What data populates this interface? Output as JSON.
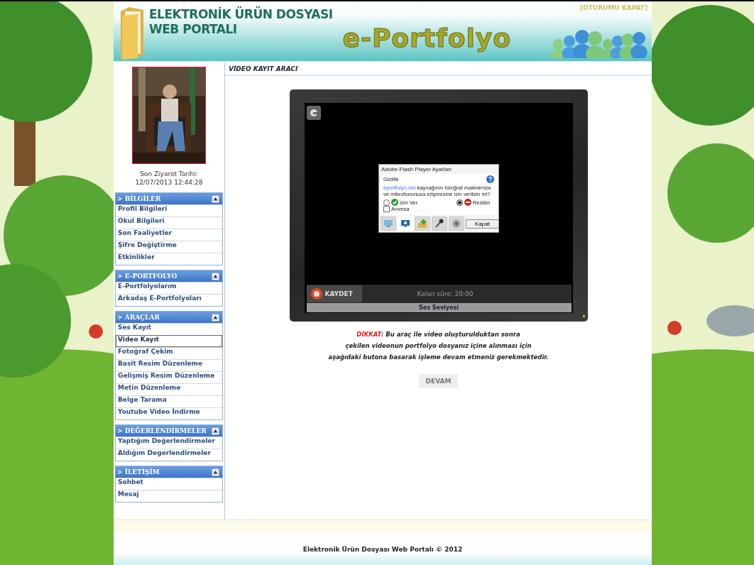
{
  "header": {
    "title_lines": [
      "ELEKTRONİK ÜRÜN DOSYASI",
      "WEB PORTALI"
    ],
    "logo": "e-Portfolyo",
    "logout_link": "[OTURUMU KAPAT]"
  },
  "profile": {
    "last_visit_label": "Son Ziyaret Tarihi:",
    "last_visit": "12/07/2013 12:44:28"
  },
  "menu": [
    {
      "title": "> BİLGİLER",
      "expanded": true,
      "items": [
        {
          "label": "Profil Bilgileri",
          "selected": false
        },
        {
          "label": "Okul Bilgileri",
          "selected": false
        },
        {
          "label": "Son Faaliyetler",
          "selected": false
        },
        {
          "label": "Şifre Değiştirme",
          "selected": false
        },
        {
          "label": "Etkinlikler",
          "selected": false
        }
      ]
    },
    {
      "title": "> E-PORTFOLYO",
      "expanded": true,
      "items": [
        {
          "label": "E-Portfolyolarım",
          "selected": false
        },
        {
          "label": "Arkadaş E-Portfolyoları",
          "selected": false
        }
      ]
    },
    {
      "title": "> ARAÇLAR",
      "expanded": true,
      "items": [
        {
          "label": "Ses Kayıt",
          "selected": false
        },
        {
          "label": "Video Kayıt",
          "selected": true
        },
        {
          "label": "Fotoğraf Çekim",
          "selected": false
        },
        {
          "label": "Basit Resim Düzenleme",
          "selected": false
        },
        {
          "label": "Gelişmiş Resim Düzenleme",
          "selected": false
        },
        {
          "label": "Metin Düzenleme",
          "selected": false
        },
        {
          "label": "Belge Tarama",
          "selected": false
        },
        {
          "label": "Youtube Video İndirme",
          "selected": false
        }
      ]
    },
    {
      "title": "> DEĞERLENDİRMELER",
      "expanded": true,
      "items": [
        {
          "label": "Yaptığım Değerlendirmeler",
          "selected": false
        },
        {
          "label": "Aldığım Degerlendirmeler",
          "selected": false
        }
      ]
    },
    {
      "title": "> İLETİŞİM",
      "expanded": true,
      "items": [
        {
          "label": "Sohbet",
          "selected": false
        },
        {
          "label": "Mesaj",
          "selected": false
        }
      ]
    }
  ],
  "page_title": "VİDEO KAYIT ARACI",
  "recorder": {
    "record_button": "KAYDET",
    "time_left": "Kalan süre: 20:00",
    "sound_level_label": "Ses Seviyesi",
    "flash_dialog": {
      "title": "Adobe Flash Player Ayarları",
      "section": "Gizlilik",
      "link": "eportfolyo.net",
      "message": "kaynağının fotoğraf makinenize ve mikrofonunuza erişmesine izin verilsin mi?",
      "options": [
        {
          "label": "İzin Ver",
          "kind": "allow",
          "selected": false
        },
        {
          "label": "Reddet",
          "kind": "deny",
          "selected": true
        }
      ],
      "remember": {
        "label": "Anımsa",
        "checked": false
      },
      "tabs": [
        {
          "kind": "display",
          "selected": false
        },
        {
          "kind": "camera-display",
          "selected": true
        },
        {
          "kind": "storage",
          "selected": false
        },
        {
          "kind": "microphone",
          "selected": false
        },
        {
          "kind": "webcam",
          "selected": false
        }
      ],
      "close_button": "Kapat"
    }
  },
  "notice": {
    "label": "DİKKAT:",
    "lines": [
      "Bu araç ile video oluşturulduktan sonra",
      "çekilen videonun portfolyo dosyanız içine alınması için",
      "aşağıdaki butona basarak işleme devam etmeniz gerekmektedir."
    ]
  },
  "continue_button": "DEVAM",
  "footer": "Elektronik Ürün Dosyası Web Portalı © 2012"
}
